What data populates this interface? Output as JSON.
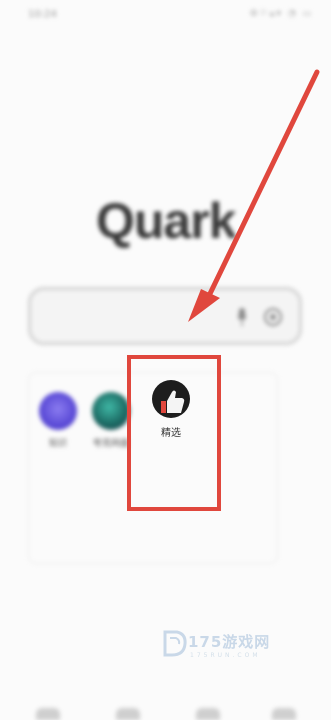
{
  "status_bar": {
    "time": "10:24",
    "icons": "⚙⚐▴▾ ◔ ▭"
  },
  "logo": {
    "text": "Quark"
  },
  "search": {
    "placeholder": "",
    "value": ""
  },
  "apps": [
    {
      "label": "知识",
      "icon": "purple-app-icon",
      "color": "#6a5ae0"
    },
    {
      "label": "夸克网盘",
      "icon": "green-app-icon",
      "color": "#1f6f66"
    },
    {
      "label": "精选",
      "icon": "thumbs-up-icon",
      "color": "#1d1d1d"
    }
  ],
  "highlight": {
    "color": "#e0473d"
  },
  "watermark": {
    "text": "175游戏网",
    "sub": "175RUN.COM"
  },
  "bottom_nav": [
    "home",
    "tabs",
    "cloud",
    "me"
  ]
}
